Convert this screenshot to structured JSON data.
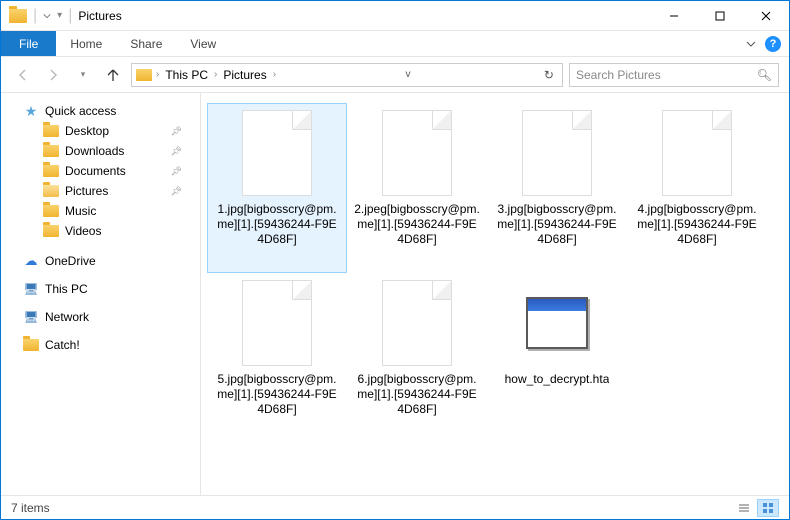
{
  "titlebar": {
    "title": "Pictures"
  },
  "ribbon": {
    "file": "File",
    "tabs": [
      "Home",
      "Share",
      "View"
    ]
  },
  "address": {
    "crumbs": [
      "This PC",
      "Pictures"
    ],
    "search_placeholder": "Search Pictures"
  },
  "sidebar": {
    "quick_access": "Quick access",
    "quick_items": [
      {
        "label": "Desktop",
        "pinned": true
      },
      {
        "label": "Downloads",
        "pinned": true
      },
      {
        "label": "Documents",
        "pinned": true
      },
      {
        "label": "Pictures",
        "pinned": true,
        "current": true
      },
      {
        "label": "Music",
        "pinned": false
      },
      {
        "label": "Videos",
        "pinned": false
      }
    ],
    "places": [
      {
        "label": "OneDrive",
        "icon": "cloud"
      },
      {
        "label": "This PC",
        "icon": "pc"
      },
      {
        "label": "Network",
        "icon": "pc"
      },
      {
        "label": "Catch!",
        "icon": "folder"
      }
    ]
  },
  "files": [
    {
      "name": "1.jpg[bigbosscry@pm.me][1].[59436244-F9E4D68F]",
      "type": "blank",
      "selected": true
    },
    {
      "name": "2.jpeg[bigbosscry@pm.me][1].[59436244-F9E4D68F]",
      "type": "blank"
    },
    {
      "name": "3.jpg[bigbosscry@pm.me][1].[59436244-F9E4D68F]",
      "type": "blank"
    },
    {
      "name": "4.jpg[bigbosscry@pm.me][1].[59436244-F9E4D68F]",
      "type": "blank"
    },
    {
      "name": "5.jpg[bigbosscry@pm.me][1].[59436244-F9E4D68F]",
      "type": "blank"
    },
    {
      "name": "6.jpg[bigbosscry@pm.me][1].[59436244-F9E4D68F]",
      "type": "blank"
    },
    {
      "name": "how_to_decrypt.hta",
      "type": "hta"
    }
  ],
  "status": {
    "count": "7 items"
  }
}
